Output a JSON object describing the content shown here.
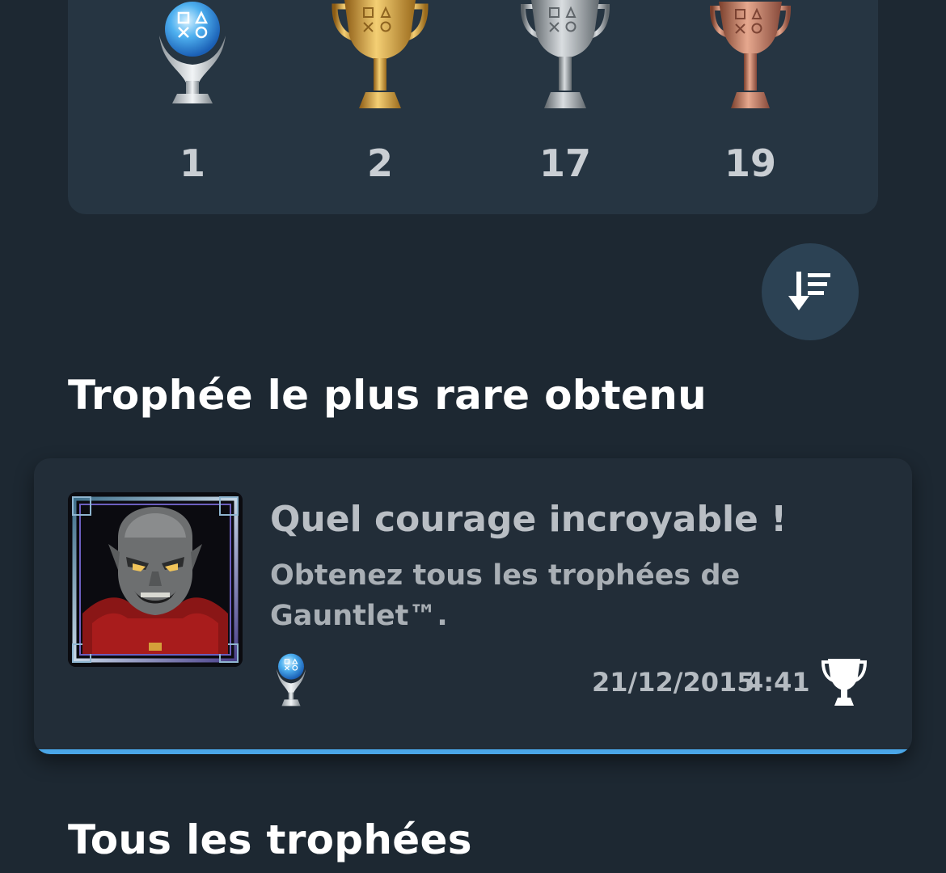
{
  "summary": {
    "trophies": [
      {
        "grade": "platinum",
        "icon": "platinum-trophy-icon",
        "count": "1"
      },
      {
        "grade": "gold",
        "icon": "gold-trophy-icon",
        "count": "2"
      },
      {
        "grade": "silver",
        "icon": "silver-trophy-icon",
        "count": "17"
      },
      {
        "grade": "bronze",
        "icon": "bronze-trophy-icon",
        "count": "19"
      }
    ]
  },
  "sort_button": {
    "icon": "sort-descending-icon"
  },
  "rarest_section": {
    "title": "Trophée le plus rare obtenu",
    "trophy": {
      "name": "Quel courage incroyable !",
      "description": "Obtenez tous les trophées de Gauntlet™.",
      "grade_icon": "platinum-trophy-icon",
      "date": "21/12/2015",
      "time": "4:41",
      "earned_icon": "trophy-earned-icon"
    }
  },
  "all_section": {
    "title": "Tous les trophées"
  },
  "colors": {
    "background": "#1d2832",
    "card": "#263542",
    "accent": "#4aa6e8"
  }
}
